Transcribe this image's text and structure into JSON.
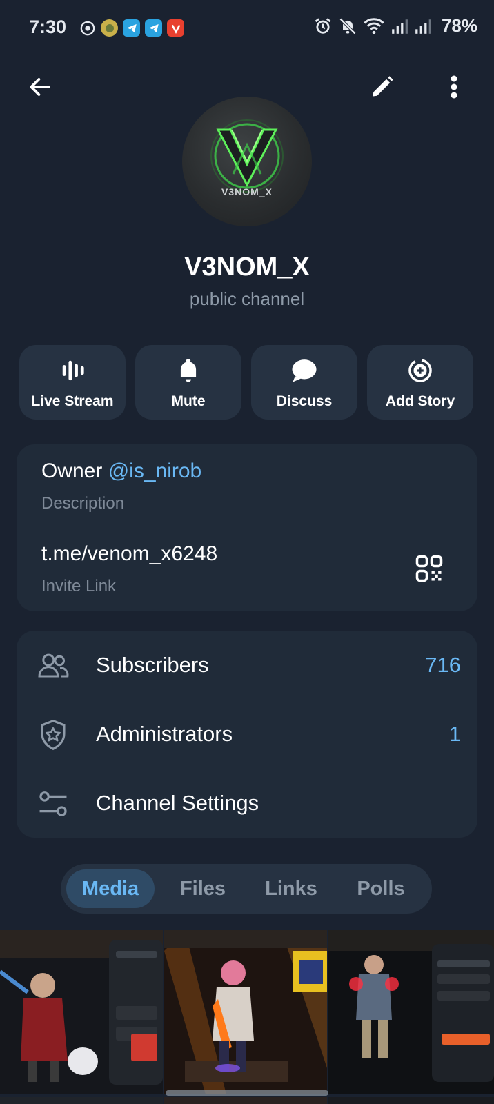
{
  "status_bar": {
    "time": "7:30",
    "battery": "78%"
  },
  "channel": {
    "title": "V3NOM_X",
    "subtitle": "public channel",
    "avatar_caption": "V3NOM_X"
  },
  "actions": [
    {
      "label": "Live Stream",
      "icon": "live-stream-icon"
    },
    {
      "label": "Mute",
      "icon": "bell-icon"
    },
    {
      "label": "Discuss",
      "icon": "chat-bubble-icon"
    },
    {
      "label": "Add Story",
      "icon": "add-story-icon"
    }
  ],
  "info": {
    "owner_prefix": "Owner ",
    "owner_mention": "@is_nirob",
    "description_label": "Description",
    "link": "t.me/venom_x6248",
    "link_label": "Invite Link"
  },
  "list": [
    {
      "label": "Subscribers",
      "value": "716",
      "icon": "people-icon"
    },
    {
      "label": "Administrators",
      "value": "1",
      "icon": "shield-star-icon"
    },
    {
      "label": "Channel Settings",
      "value": "",
      "icon": "sliders-icon"
    }
  ],
  "tabs": [
    {
      "label": "Media",
      "active": true
    },
    {
      "label": "Files",
      "active": false
    },
    {
      "label": "Links",
      "active": false
    },
    {
      "label": "Polls",
      "active": false
    }
  ],
  "colors": {
    "background": "#1a2230",
    "card": "#202b39",
    "accent": "#6ab8f4",
    "secondary_text": "#8e9aa8"
  }
}
